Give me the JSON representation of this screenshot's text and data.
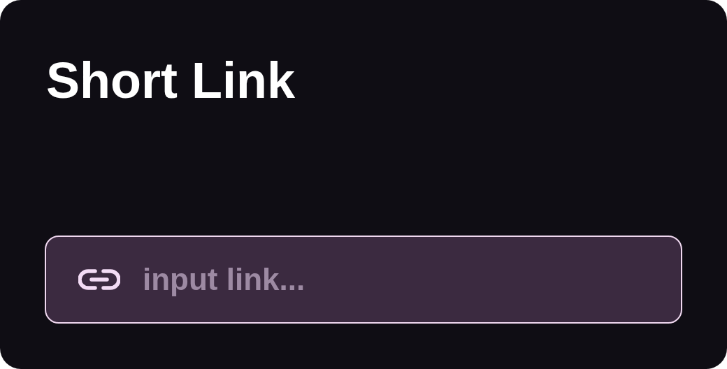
{
  "title": "Short Link",
  "link_field": {
    "placeholder": "input link..."
  }
}
